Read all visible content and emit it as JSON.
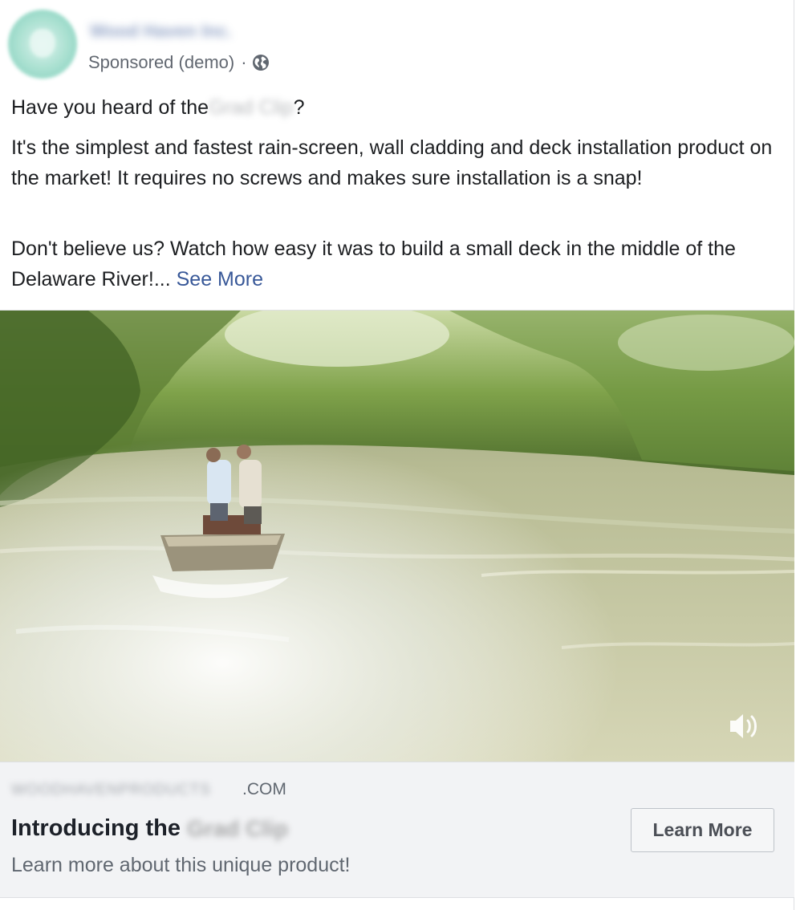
{
  "header": {
    "page_name": "Wood Haven Inc.",
    "sponsored_label": "Sponsored (demo)",
    "separator": "·",
    "privacy_icon": "globe-icon"
  },
  "post": {
    "p1_prefix": "Have you heard of the",
    "p1_product": "Grad Clip",
    "p1_suffix": "?",
    "p2": "It's the simplest and fastest rain-screen, wall cladding and deck installation product on the market! It requires no screws and makes sure installation is a snap!",
    "p3": "Don't believe us? Watch how easy it was to build a small deck in the middle of the Delaware River!...",
    "see_more": "See More"
  },
  "video": {
    "sound_icon": "speaker-sound-on-icon"
  },
  "link_card": {
    "domain_blurred": "WOODHAVENPRODUCTS",
    "domain_suffix": ".COM",
    "headline_prefix": "Introducing the",
    "headline_product": "Grad Clip",
    "description": "Learn more about this unique product!",
    "cta_label": "Learn More"
  },
  "colors": {
    "link_blue": "#385898",
    "secondary_text": "#606770",
    "card_background": "#f2f3f5"
  }
}
